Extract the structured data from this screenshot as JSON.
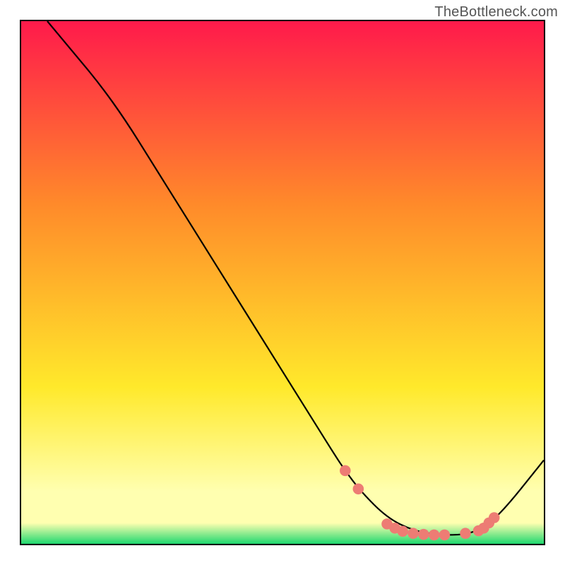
{
  "watermark": "TheBottleneck.com",
  "colors": {
    "border": "#000000",
    "curve": "#000000",
    "dots": "#ED7C74",
    "grad_top": "#FF1A4B",
    "grad_mid1": "#FF8A2A",
    "grad_mid2": "#FFE92B",
    "grad_mid3": "#FFFFB0",
    "grad_bottom": "#1FD86F"
  },
  "chart_data": {
    "type": "line",
    "title": "",
    "xlabel": "",
    "ylabel": "",
    "xlim": [
      0,
      100
    ],
    "ylim": [
      0,
      100
    ],
    "grid": false,
    "legend": false,
    "series": [
      {
        "name": "curve",
        "x": [
          5,
          10,
          15,
          20,
          25,
          30,
          35,
          40,
          45,
          50,
          55,
          60,
          62,
          65,
          70,
          75,
          80,
          82,
          85,
          88,
          92,
          100
        ],
        "y": [
          100,
          94,
          88,
          81,
          73,
          65,
          57,
          49,
          41,
          33,
          25,
          17,
          14,
          10,
          5,
          2.5,
          1.7,
          1.7,
          1.8,
          2.8,
          6,
          16
        ]
      }
    ],
    "dots": {
      "name": "dots",
      "points": [
        {
          "x": 62.0,
          "y": 14.0
        },
        {
          "x": 64.5,
          "y": 10.5
        },
        {
          "x": 70.0,
          "y": 3.8
        },
        {
          "x": 71.5,
          "y": 3.0
        },
        {
          "x": 73.0,
          "y": 2.4
        },
        {
          "x": 75.0,
          "y": 2.0
        },
        {
          "x": 77.0,
          "y": 1.8
        },
        {
          "x": 79.0,
          "y": 1.7
        },
        {
          "x": 81.0,
          "y": 1.7
        },
        {
          "x": 85.0,
          "y": 2.0
        },
        {
          "x": 87.5,
          "y": 2.5
        },
        {
          "x": 88.5,
          "y": 3.0
        },
        {
          "x": 89.5,
          "y": 4.0
        },
        {
          "x": 90.5,
          "y": 5.0
        }
      ]
    }
  }
}
